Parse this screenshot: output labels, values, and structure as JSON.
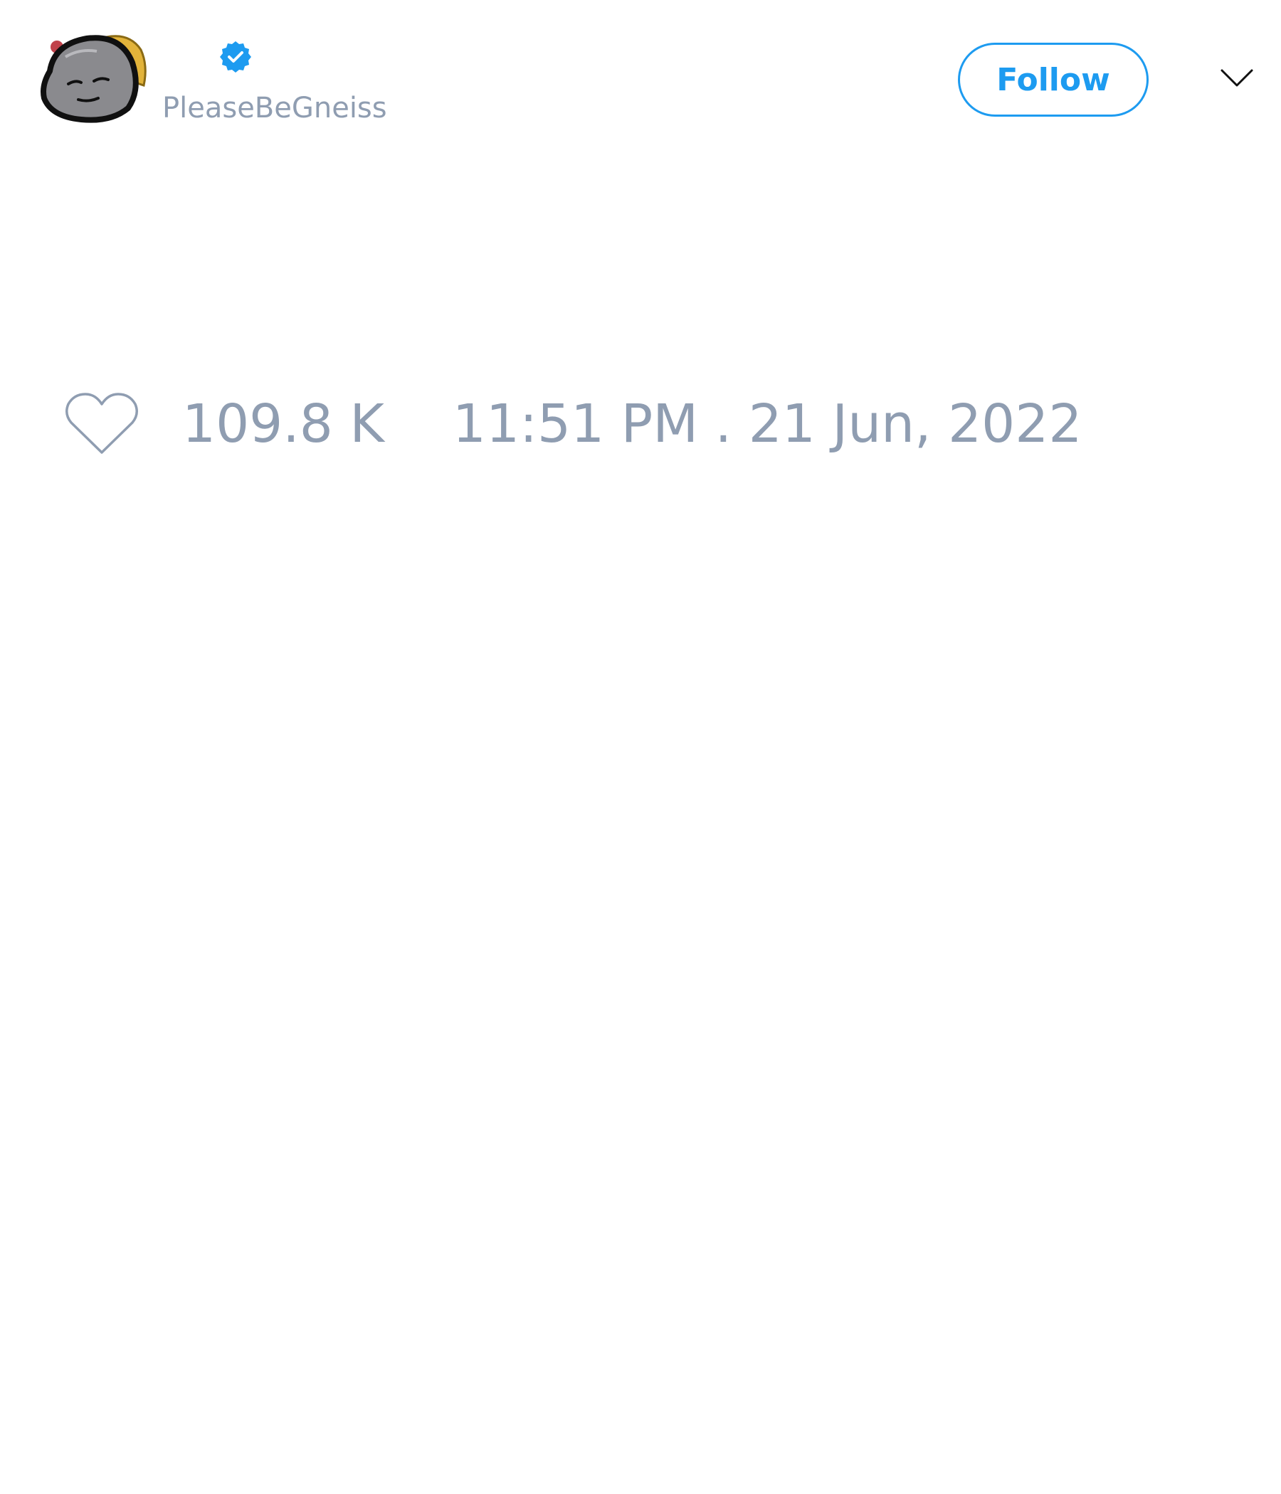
{
  "tweet": {
    "author": {
      "handle": "PleaseBeGneiss",
      "avatar_icon": "rock-face-avatar",
      "verified": true,
      "verified_icon": "verified-badge-icon"
    },
    "actions": {
      "follow_label": "Follow",
      "menu_icon": "chevron-down-icon"
    },
    "stats": {
      "like_icon": "heart-outline-icon",
      "like_count": "109.8 K",
      "timestamp": "11:51 PM . 21 Jun, 2022"
    }
  },
  "colors": {
    "accent": "#1d9bf0",
    "muted_text": "#8f9db1",
    "background": "#ffffff"
  }
}
